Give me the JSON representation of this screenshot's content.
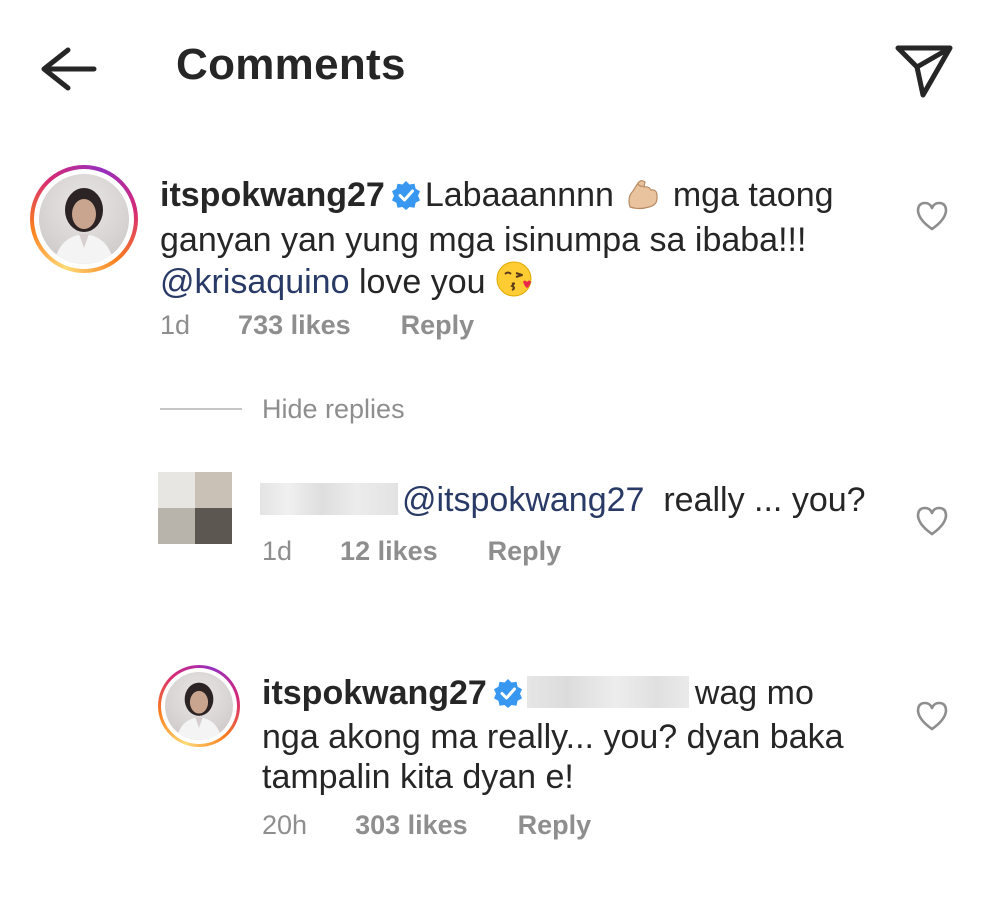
{
  "header": {
    "title": "Comments",
    "back_icon": "arrow-left-icon",
    "share_icon": "paper-plane-icon"
  },
  "comments": [
    {
      "username": "itspokwang27",
      "verified": true,
      "text_part1": "Labaaannnn",
      "emoji1": "flexed-biceps",
      "text_part2": "mga taong",
      "line2": "ganyan yan yung mga isinumpa sa ibaba!!!",
      "mention": "@krisaquino",
      "text_part3": "love you",
      "emoji2": "kissing-face",
      "time": "1d",
      "likes": "733 likes",
      "reply_label": "Reply"
    }
  ],
  "replies_toggle": "Hide replies",
  "replies": [
    {
      "username_hidden": true,
      "mention": "@itspokwang27",
      "text": "really ... you?",
      "time": "1d",
      "likes": "12 likes",
      "reply_label": "Reply"
    },
    {
      "username": "itspokwang27",
      "verified": true,
      "mention_hidden": true,
      "text_line1": "wag mo",
      "text_line2": "nga akong ma really... you? dyan baka",
      "text_line3": "tampalin kita dyan e!",
      "time": "20h",
      "likes": "303 likes",
      "reply_label": "Reply"
    }
  ],
  "colors": {
    "text": "#262626",
    "secondary": "#8e8e8e",
    "mention": "#2a3a66",
    "verified": "#3897f0"
  }
}
